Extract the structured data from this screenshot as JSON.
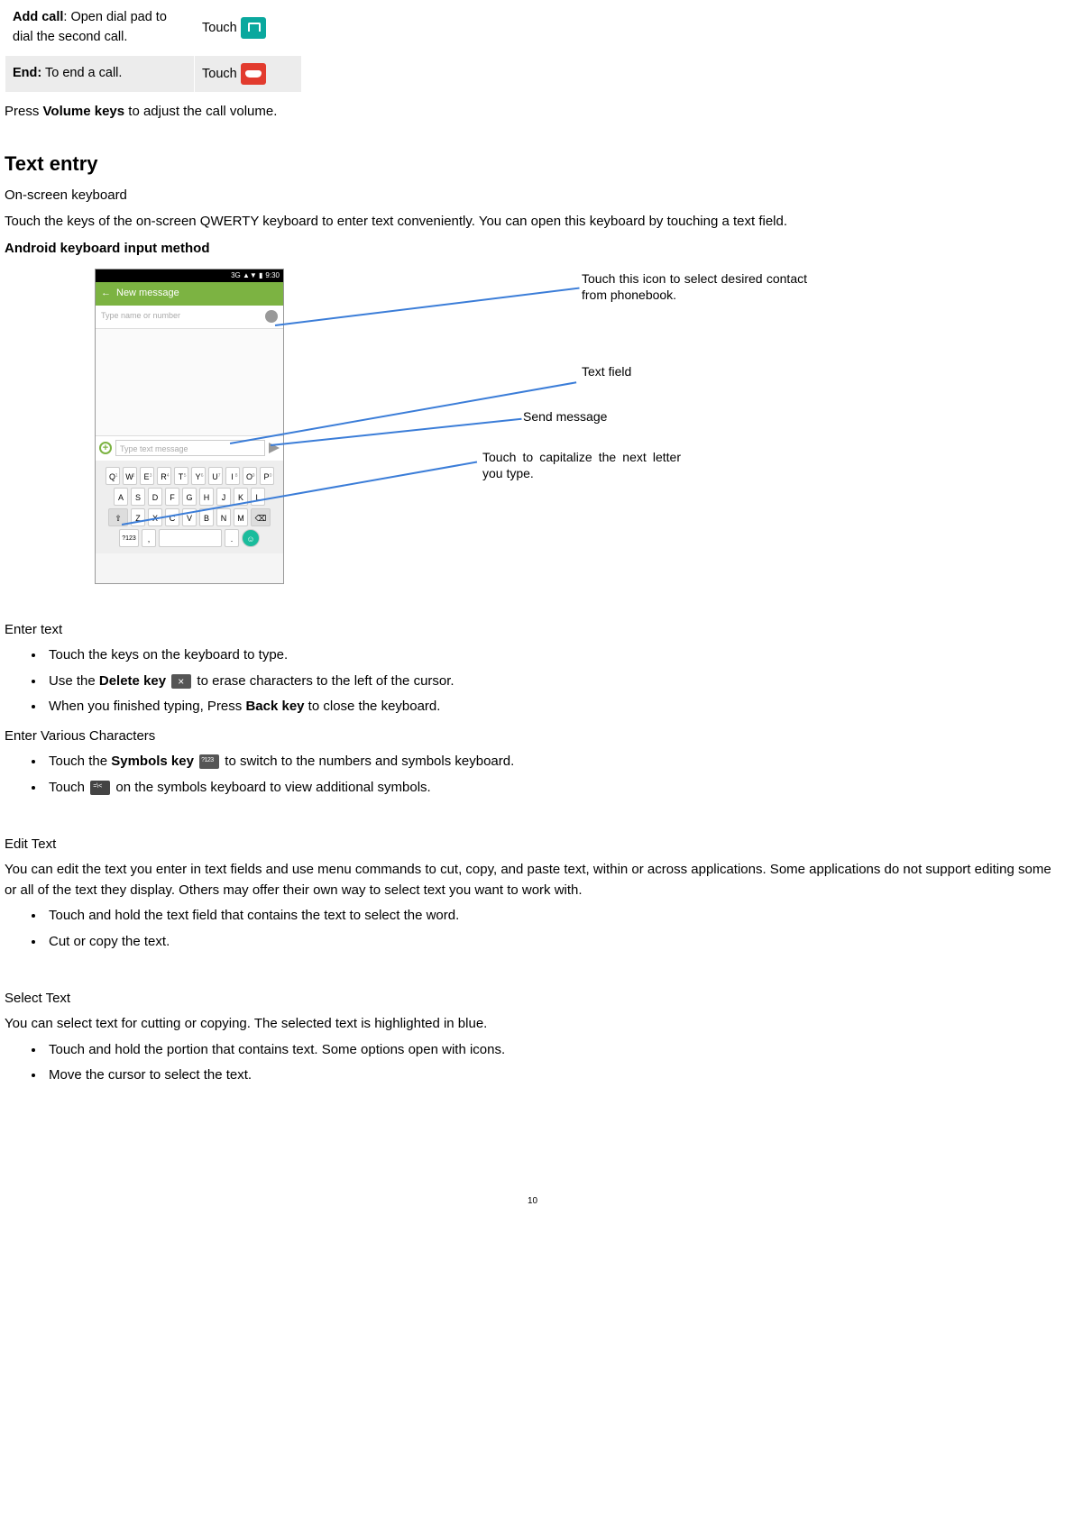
{
  "table": {
    "row1_label": "Add call",
    "row1_desc": ": Open dial pad to dial the second call.",
    "row1_action": "Touch",
    "row2_label": "End:",
    "row2_desc": " To end a call.",
    "row2_action": "Touch"
  },
  "volume_line_pre": "Press ",
  "volume_keys": "Volume keys",
  "volume_line_post": " to adjust the call volume.",
  "section_title": "Text entry",
  "onscreen_heading": "On-screen keyboard",
  "onscreen_desc": "Touch the keys of the on-screen QWERTY keyboard to enter text conveniently. You can open this keyboard by touching a text field.",
  "android_kbd_heading": "Android keyboard input method",
  "mock": {
    "status_time": "9:30",
    "status_icons": "3G ▲▼ ▮",
    "header_back": "←",
    "header_title": "New message",
    "to_placeholder": "Type name or number",
    "compose_placeholder": "Type text message",
    "row1": [
      "Q",
      "W",
      "E",
      "R",
      "T",
      "Y",
      "U",
      "I",
      "O",
      "P"
    ],
    "row1_sup": [
      "1",
      "2",
      "3",
      "4",
      "5",
      "6",
      "7",
      "8",
      "9",
      "0"
    ],
    "row2": [
      "A",
      "S",
      "D",
      "F",
      "G",
      "H",
      "J",
      "K",
      "L"
    ],
    "row3": [
      "Z",
      "X",
      "C",
      "V",
      "B",
      "N",
      "M"
    ],
    "shift": "⇧",
    "del": "⌫",
    "numkey": "?123",
    "comma": ",",
    "period": ".",
    "emoji": "☺"
  },
  "callouts": {
    "contact": "Touch this icon to select desired contact from phonebook.",
    "textfield": "Text field",
    "send": "Send message",
    "shift": "Touch to capitalize the next letter you type."
  },
  "enter_text_heading": "Enter text",
  "enter_text_items": {
    "i1": "Touch the keys on the keyboard to type.",
    "i2_pre": "Use the ",
    "i2_bold": "Delete key",
    "i2_post": " to erase characters to the left of the cursor.",
    "i3_pre": "When you finished typing, Press ",
    "i3_bold": "Back key",
    "i3_post": " to close the keyboard."
  },
  "various_heading": "Enter Various Characters",
  "various_items": {
    "i1_pre": "Touch the ",
    "i1_bold": "Symbols key",
    "i1_post": " to switch to the numbers and symbols keyboard.",
    "i2_pre": "Touch ",
    "i2_post": " on the symbols keyboard to view additional symbols."
  },
  "edit_heading": "Edit Text",
  "edit_desc": "You can edit the text you enter in text fields and use menu commands to cut, copy, and paste text, within or across applications. Some applications do not support editing some or all of the text they display. Others may offer their own way to select text you want to work with.",
  "edit_items": {
    "i1": "Touch and hold the text field that contains the text to select the word.",
    "i2": "Cut or copy the text."
  },
  "select_heading": "Select Text",
  "select_desc": "You can select text for cutting or copying. The selected text is highlighted in blue.",
  "select_items": {
    "i1": "Touch and hold the portion that contains text. Some options open with icons.",
    "i2": "Move the cursor to select the text."
  },
  "page_number": "10"
}
